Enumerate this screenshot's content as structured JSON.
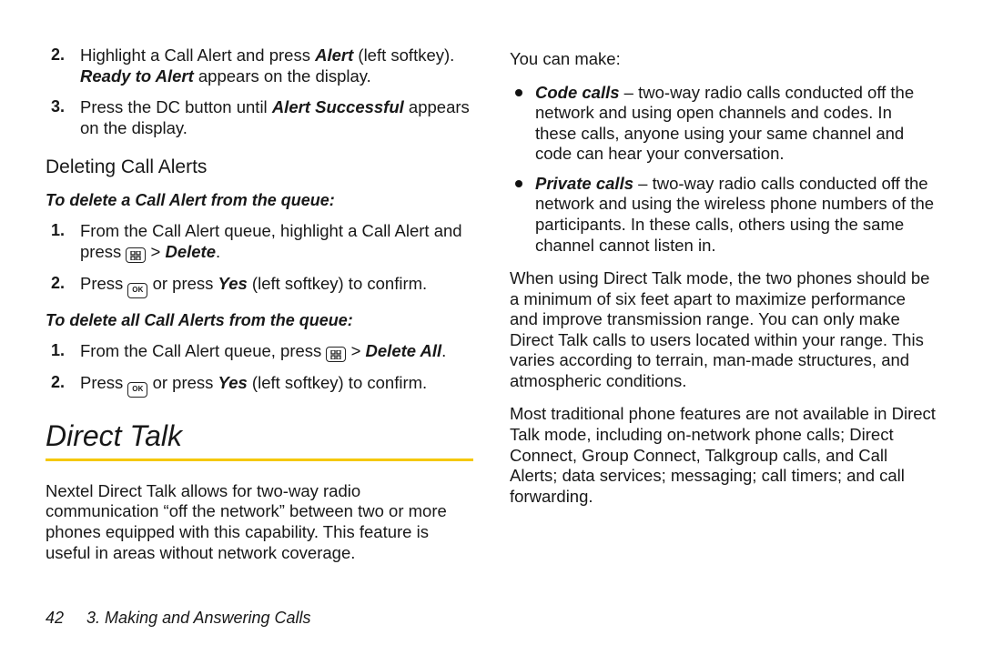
{
  "colLeft": {
    "stepsTop": [
      {
        "num": "2.",
        "parts": [
          {
            "t": "Highlight a Call Alert and press "
          },
          {
            "t": "Alert",
            "cls": "bold-italic"
          },
          {
            "t": " (left softkey). "
          },
          {
            "t": "Ready to Alert",
            "cls": "bold-italic"
          },
          {
            "t": " appears on the display."
          }
        ]
      },
      {
        "num": "3.",
        "parts": [
          {
            "t": "Press the DC button until "
          },
          {
            "t": "Alert Successful",
            "cls": "bold-italic"
          },
          {
            "t": " appears on the display."
          }
        ]
      }
    ],
    "subhead1": "Deleting Call Alerts",
    "emph1": "To delete a Call Alert from the queue:",
    "listA": [
      {
        "num": "1.",
        "parts": [
          {
            "t": "From the Call Alert queue, highlight a Call Alert and press "
          },
          {
            "icon": "menu"
          },
          {
            "t": " > "
          },
          {
            "t": "Delete",
            "cls": "bold-italic"
          },
          {
            "t": "."
          }
        ]
      },
      {
        "num": "2.",
        "parts": [
          {
            "t": "Press "
          },
          {
            "icon": "ok"
          },
          {
            "t": " or press "
          },
          {
            "t": "Yes",
            "cls": "bold-italic"
          },
          {
            "t": " (left softkey) to confirm."
          }
        ]
      }
    ],
    "emph2": "To delete all Call Alerts from the queue:",
    "listB": [
      {
        "num": "1.",
        "parts": [
          {
            "t": "From the Call Alert queue, press "
          },
          {
            "icon": "menu"
          },
          {
            "t": " > "
          },
          {
            "t": "Delete All",
            "cls": "bold-italic"
          },
          {
            "t": "."
          }
        ]
      },
      {
        "num": "2.",
        "parts": [
          {
            "t": "Press "
          },
          {
            "icon": "ok"
          },
          {
            "t": " or press "
          },
          {
            "t": "Yes",
            "cls": "bold-italic"
          },
          {
            "t": " (left softkey) to confirm."
          }
        ]
      }
    ],
    "section_heading": "Direct Talk",
    "section_intro": "Nextel Direct Talk allows for two-way radio communication “off the network” between two or more phones equipped with this capability. This feature is useful in areas without network coverage."
  },
  "colRight": {
    "lead": "You can make:",
    "bullets": [
      {
        "parts": [
          {
            "t": "Code calls",
            "cls": "bold-italic"
          },
          {
            "t": " – two-way radio calls conducted off the network and using open channels and codes. In these calls, anyone using your same channel and code can hear your conversation."
          }
        ]
      },
      {
        "parts": [
          {
            "t": "Private calls",
            "cls": "bold-italic"
          },
          {
            "t": " – two-way radio calls conducted off the network and using the wireless phone numbers of the participants. In these calls, others using the same channel cannot listen in."
          }
        ]
      }
    ],
    "para1": "When using Direct Talk mode, the two phones should be a minimum of six feet apart to maximize performance and improve transmission range. You can only make Direct Talk calls to users located within your range. This varies according to terrain, man-made structures, and atmospheric conditions.",
    "para2": "Most traditional phone features are not available in Direct Talk mode, including on-network phone calls; Direct Connect, Group Connect, Talkgroup calls, and Call Alerts; data services; messaging; call timers; and call forwarding."
  },
  "footer": {
    "page_number": "42",
    "chapter": "3. Making and Answering Calls"
  },
  "icons": {
    "ok_label": "OK"
  }
}
